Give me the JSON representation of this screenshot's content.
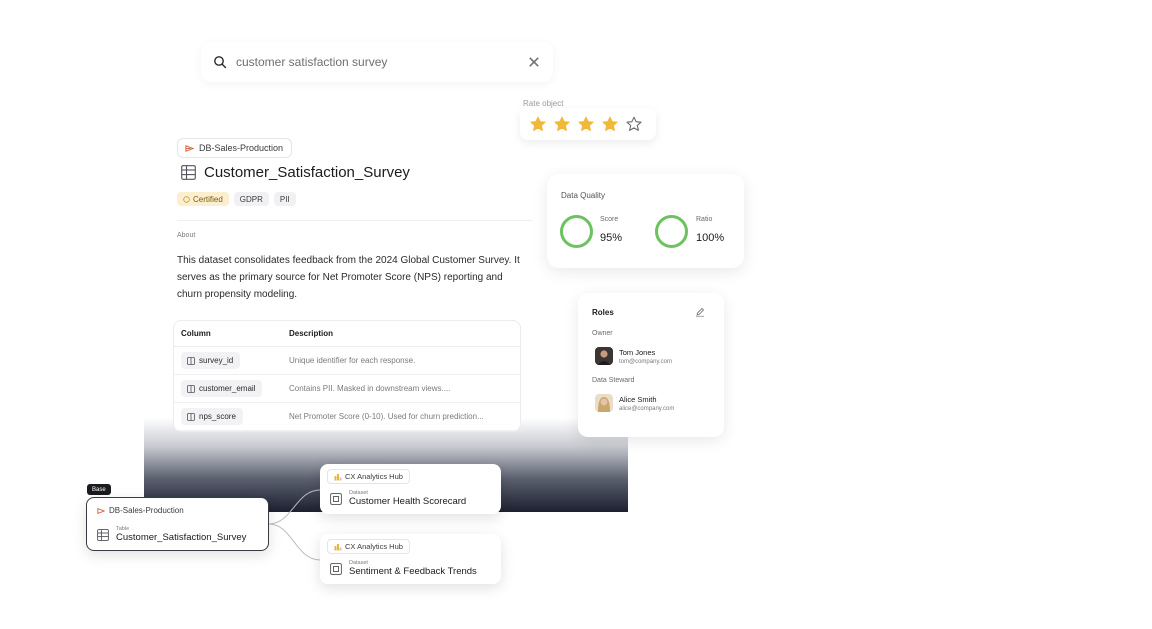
{
  "search": {
    "query": "customer satisfaction survey"
  },
  "rating": {
    "label": "Rate object",
    "value": 4,
    "max": 5,
    "color": "#f0b93a"
  },
  "dataset": {
    "source": "DB-Sales-Production",
    "title": "Customer_Satisfaction_Survey",
    "tags": [
      "Certified",
      "GDPR",
      "PII"
    ],
    "about_label": "About",
    "about_text": "This dataset consolidates feedback from the 2024 Global Customer Survey. It serves as the primary source for Net Promoter Score (NPS) reporting and churn propensity modeling.",
    "columns_header": {
      "column": "Column",
      "description": "Description"
    },
    "columns": [
      {
        "name": "survey_id",
        "description": "Unique identifier for each response."
      },
      {
        "name": "customer_email",
        "description": "Contains PII. Masked in downstream views...."
      },
      {
        "name": "nps_score",
        "description": "Net Promoter Score (0-10). Used for churn prediction..."
      }
    ]
  },
  "data_quality": {
    "title": "Data Quality",
    "metrics": [
      {
        "label": "Score",
        "value": "95%"
      },
      {
        "label": "Ratio",
        "value": "100%"
      }
    ],
    "accent": "#6cc25f"
  },
  "roles": {
    "title": "Roles",
    "owner_label": "Owner",
    "owner": {
      "name": "Tom Jones",
      "email": "tom@company.com"
    },
    "steward_label": "Data Steward",
    "steward": {
      "name": "Alice Smith",
      "email": "alice@company.com"
    }
  },
  "lineage": {
    "base_badge": "Base",
    "base": {
      "source": "DB-Sales-Production",
      "type": "Table",
      "name": "Customer_Satisfaction_Survey"
    },
    "downstream": [
      {
        "hub": "CX Analytics Hub",
        "type": "Dataset",
        "name": "Customer Health Scorecard"
      },
      {
        "hub": "CX Analytics Hub",
        "type": "Dataset",
        "name": "Sentiment & Feedback Trends"
      }
    ]
  }
}
